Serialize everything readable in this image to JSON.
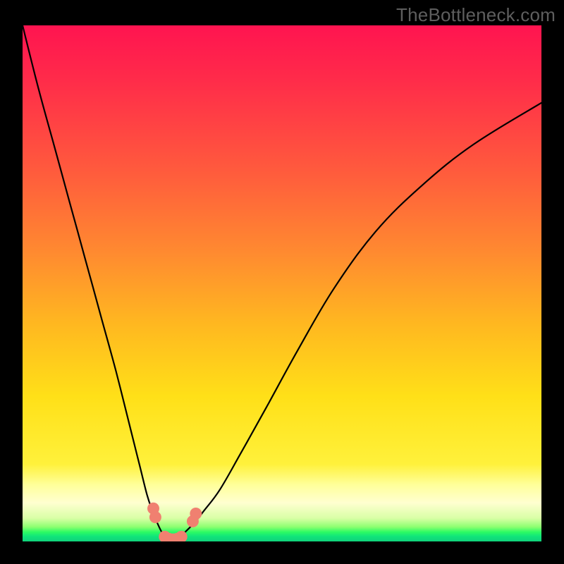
{
  "watermark": "TheBottleneck.com",
  "chart_data": {
    "type": "line",
    "title": "",
    "xlabel": "",
    "ylabel": "",
    "xlim": [
      0,
      100
    ],
    "ylim": [
      0,
      100
    ],
    "series": [
      {
        "name": "bottleneck-curve",
        "x": [
          0,
          3,
          6,
          9,
          12,
          15,
          18,
          21,
          22.5,
          24,
          25,
          26,
          27,
          28,
          29,
          30,
          31,
          33,
          35,
          38,
          42,
          47,
          53,
          60,
          68,
          77,
          87,
          100
        ],
        "y": [
          100,
          88,
          77,
          66,
          55,
          44,
          33,
          21,
          15,
          9,
          6,
          3.5,
          1.5,
          0.5,
          0,
          0.5,
          1.5,
          3.5,
          6,
          10,
          17,
          26,
          37,
          49,
          60,
          69,
          77,
          85
        ]
      }
    ],
    "markers": {
      "name": "highlight-points",
      "color": "#f08070",
      "points": [
        {
          "x": 25.2,
          "y": 6.4
        },
        {
          "x": 25.6,
          "y": 4.7
        },
        {
          "x": 27.4,
          "y": 0.9
        },
        {
          "x": 28.2,
          "y": 0.5
        },
        {
          "x": 29.0,
          "y": 0.4
        },
        {
          "x": 29.8,
          "y": 0.5
        },
        {
          "x": 30.6,
          "y": 0.9
        },
        {
          "x": 32.8,
          "y": 3.9
        },
        {
          "x": 33.4,
          "y": 5.4
        }
      ]
    },
    "gradient_stops": [
      {
        "pos": 0,
        "color": "#ff1450"
      },
      {
        "pos": 50,
        "color": "#ff9a28"
      },
      {
        "pos": 85,
        "color": "#fff13b"
      },
      {
        "pos": 93,
        "color": "#ffffd0"
      },
      {
        "pos": 100,
        "color": "#0fd27b"
      }
    ]
  }
}
